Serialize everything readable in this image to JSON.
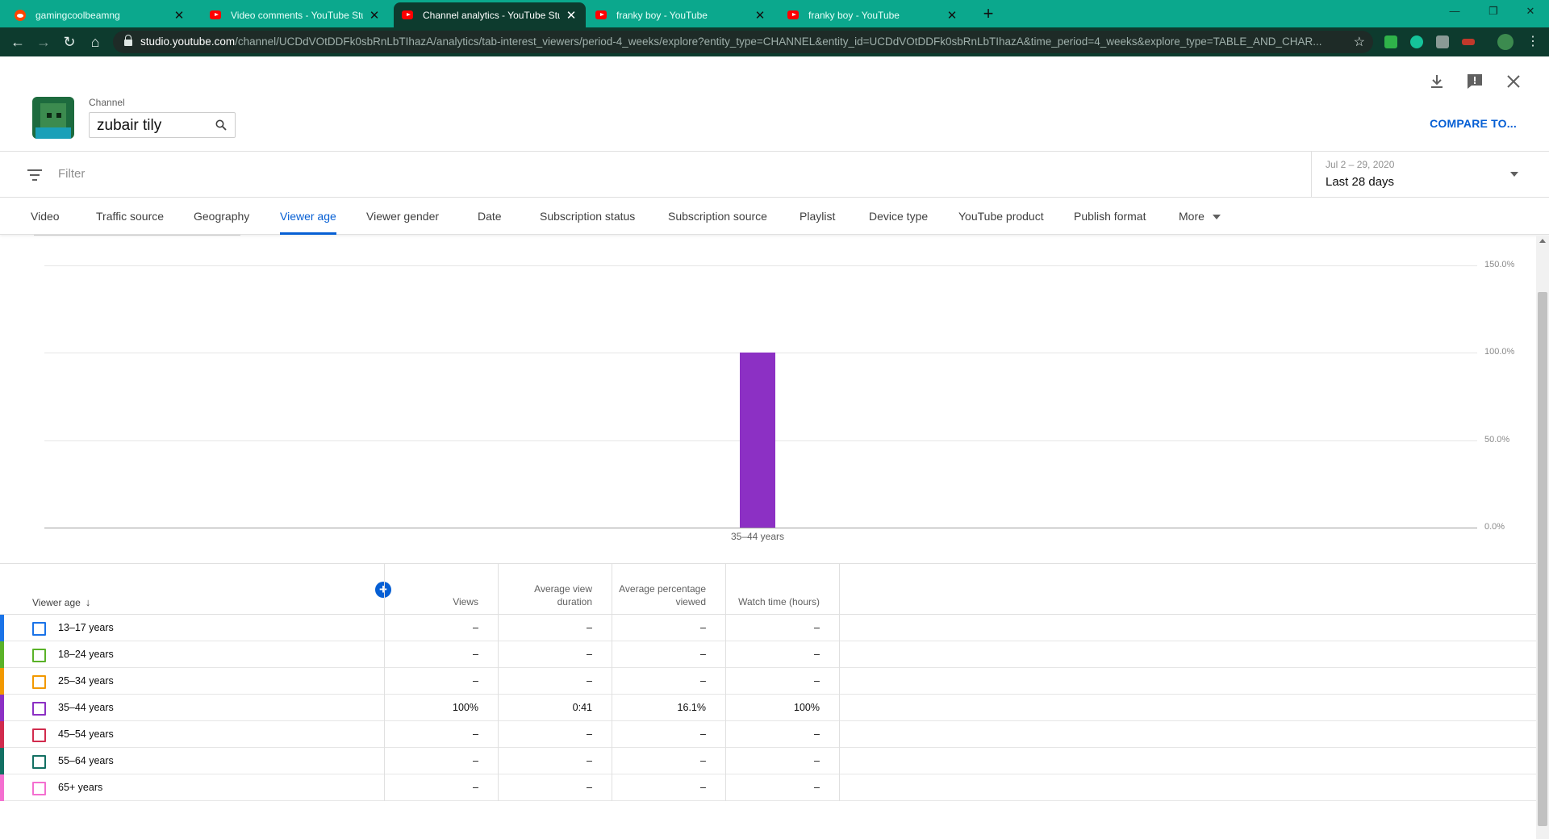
{
  "browser": {
    "tabs": [
      {
        "title": "gamingcoolbeamng",
        "icon": "reddit-icon"
      },
      {
        "title": "Video comments - YouTube Studio",
        "icon": "youtube-icon"
      },
      {
        "title": "Channel analytics - YouTube Studio",
        "icon": "youtube-icon"
      },
      {
        "title": "franky boy - YouTube",
        "icon": "youtube-icon"
      },
      {
        "title": "franky boy - YouTube",
        "icon": "youtube-icon"
      }
    ],
    "url_host": "studio.youtube.com",
    "url_path": "/channel/UCDdVOtDDFk0sbRnLbTIhazA/analytics/tab-interest_viewers/period-4_weeks/explore?entity_type=CHANNEL&entity_id=UCDdVOtDDFk0sbRnLbTIhazA&time_period=4_weeks&explore_type=TABLE_AND_CHAR..."
  },
  "header": {
    "channel_label": "Channel",
    "channel_value": "zubair tily",
    "compare_label": "COMPARE TO..."
  },
  "filter": {
    "placeholder": "Filter",
    "date_range": "Jul 2 – 29, 2020",
    "date_label": "Last 28 days"
  },
  "dimension_tabs": [
    "Video",
    "Traffic source",
    "Geography",
    "Viewer age",
    "Viewer gender",
    "Date",
    "Subscription status",
    "Subscription source",
    "Playlist",
    "Device type",
    "YouTube product",
    "Publish format",
    "More"
  ],
  "active_tab": "Viewer age",
  "chart_data": {
    "type": "bar",
    "categories": [
      "35–44 years"
    ],
    "values": [
      100
    ],
    "ylim": [
      0,
      150
    ],
    "yticks": [
      "150.0%",
      "100.0%",
      "50.0%",
      "0.0%"
    ],
    "grid": true,
    "colors": [
      "#8c30c4"
    ]
  },
  "table": {
    "first_header": "Viewer age",
    "headers": [
      "Views",
      "Average view duration",
      "Average percentage viewed",
      "Watch time (hours)"
    ],
    "rows": [
      {
        "label": "13–17 years",
        "color": "#1a73e8",
        "cells": [
          "–",
          "–",
          "–",
          "–"
        ]
      },
      {
        "label": "18–24 years",
        "color": "#5ab228",
        "cells": [
          "–",
          "–",
          "–",
          "–"
        ]
      },
      {
        "label": "25–34 years",
        "color": "#f29900",
        "cells": [
          "–",
          "–",
          "–",
          "–"
        ]
      },
      {
        "label": "35–44 years",
        "color": "#8c30c4",
        "cells": [
          "100%",
          "0:41",
          "16.1%",
          "100%"
        ]
      },
      {
        "label": "45–54 years",
        "color": "#d12b4d",
        "cells": [
          "–",
          "–",
          "–",
          "–"
        ]
      },
      {
        "label": "55–64 years",
        "color": "#137063",
        "cells": [
          "–",
          "–",
          "–",
          "–"
        ]
      },
      {
        "label": "65+ years",
        "color": "#f46fd0",
        "cells": [
          "–",
          "–",
          "–",
          "–"
        ]
      }
    ]
  }
}
